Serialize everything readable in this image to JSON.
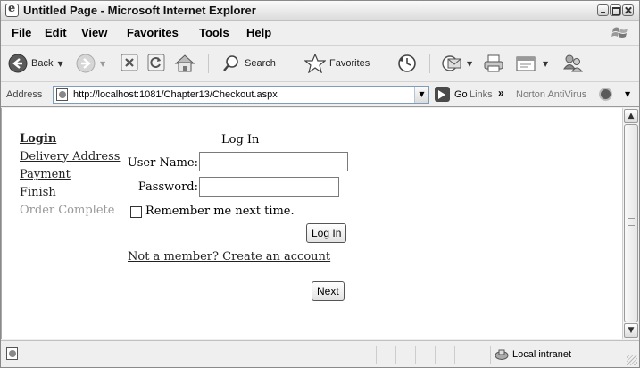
{
  "window": {
    "title": "Untitled Page - Microsoft Internet Explorer"
  },
  "menu": {
    "items": [
      "File",
      "Edit",
      "View",
      "Favorites",
      "Tools",
      "Help"
    ]
  },
  "toolbar": {
    "back_label": "Back",
    "search_label": "Search",
    "favorites_label": "Favorites"
  },
  "address": {
    "label": "Address",
    "url": "http://localhost:1081/Chapter13/Checkout.aspx",
    "go_label": "Go",
    "links_label": "Links",
    "links_chevron": "»",
    "norton_label": "Norton AntiVirus"
  },
  "nav": {
    "items": [
      {
        "label": "Login",
        "state": "current"
      },
      {
        "label": "Delivery Address",
        "state": "link"
      },
      {
        "label": "Payment",
        "state": "link"
      },
      {
        "label": "Finish",
        "state": "link"
      },
      {
        "label": "Order Complete",
        "state": "disabled"
      }
    ]
  },
  "login": {
    "title": "Log In",
    "username_label": "User Name:",
    "username_value": "",
    "password_label": "Password:",
    "password_value": "",
    "remember_label": "Remember me next time.",
    "remember_checked": false,
    "login_button": "Log In",
    "create_account_link": "Not a member? Create an account"
  },
  "wizard": {
    "next_button": "Next"
  },
  "status": {
    "zone_label": "Local intranet"
  },
  "colors": {
    "disabled_text": "#999999",
    "window_chrome": "#efefef"
  }
}
